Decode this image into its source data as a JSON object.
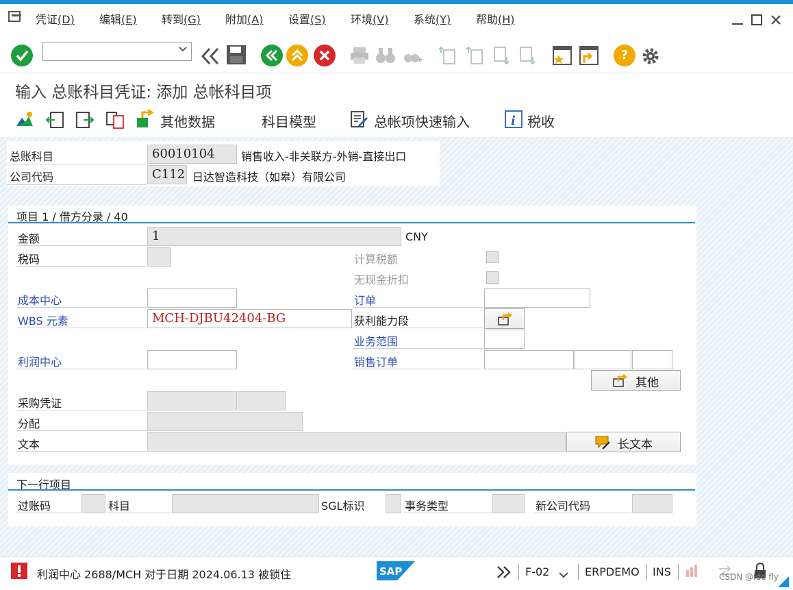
{
  "menubar": {
    "items": [
      {
        "label": "凭证",
        "key": "(D)"
      },
      {
        "label": "编辑",
        "key": "(E)"
      },
      {
        "label": "转到",
        "key": "(G)"
      },
      {
        "label": "附加",
        "key": "(A)"
      },
      {
        "label": "设置",
        "key": "(S)"
      },
      {
        "label": "环境",
        "key": "(V)"
      },
      {
        "label": "系统",
        "key": "(Y)"
      },
      {
        "label": "帮助",
        "key": "(H)"
      }
    ]
  },
  "toolbar": {
    "command_field_value": "",
    "help_icon": "?"
  },
  "screen": {
    "title": "输入 总账科目凭证: 添加 总帐科目项"
  },
  "app_toolbar": {
    "other_data": "其他数据",
    "account_model": "科目模型",
    "gl_fast_entry": "总帐项快速输入",
    "tax": "税收"
  },
  "header": {
    "gl_account_label": "总账科目",
    "gl_account_value": "60010104",
    "gl_account_desc": "销售收入-非关联方-外销-直接出口",
    "company_code_label": "公司代码",
    "company_code_value": "C112",
    "company_code_desc": "日达智造科技（如皋）有限公司"
  },
  "item": {
    "section_title": "项目 1 / 借方分录 / 40",
    "amount_label": "金额",
    "amount_value": "1",
    "currency": "CNY",
    "tax_code_label": "税码",
    "tax_code_value": "",
    "calc_tax_label": "计算税额",
    "no_cash_discount_label": "无现金折扣",
    "cost_center_label": "成本中心",
    "cost_center_value": "",
    "order_label": "订单",
    "order_value": "",
    "wbs_label": "WBS 元素",
    "wbs_value": "MCH-DJBU42404-BG",
    "profitability_label": "获利能力段",
    "business_area_label": "业务范围",
    "business_area_value": "",
    "profit_center_label": "利润中心",
    "profit_center_value": "",
    "sales_order_label": "销售订单",
    "sales_order_value": "",
    "more_button": "其他",
    "purchase_doc_label": "采购凭证",
    "assignment_label": "分配",
    "text_label": "文本",
    "text_value": "",
    "long_text_button": "长文本"
  },
  "next_line": {
    "section_title": "下一行项目",
    "posting_key_label": "过账码",
    "account_label": "科目",
    "sgl_label": "SGL标识",
    "transaction_type_label": "事务类型",
    "new_company_code_label": "新公司代码"
  },
  "status": {
    "message": "利润中心 2688/MCH 对于日期 2024.06.13 被锁住",
    "transaction": "F-02",
    "system": "ERPDEMO",
    "mode": "INS",
    "watermark": "CSDN @Ido fly"
  },
  "colors": {
    "accent": "#1a8fd6",
    "label_blue": "#2b4fb8",
    "error_red": "#d9262b",
    "ok_green": "#1f9e3f",
    "back_orange": "#f2a900"
  }
}
